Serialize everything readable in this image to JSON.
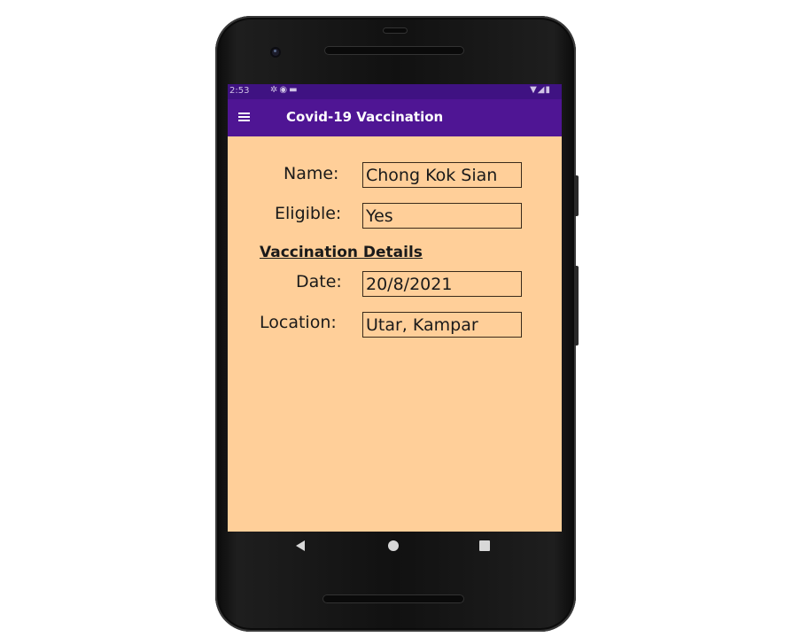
{
  "status_bar": {
    "time": "2:53",
    "left_icons": [
      "settings-icon",
      "notification-icon",
      "sd-card-icon"
    ],
    "right_icons": [
      "wifi-icon",
      "signal-icon",
      "battery-icon"
    ]
  },
  "app_bar": {
    "title": "Covid-19 Vaccination",
    "menu_icon": "hamburger-menu-icon",
    "background": "#4f1594"
  },
  "form": {
    "name_label": "Name:",
    "name_value": "Chong Kok Sian",
    "eligible_label": "Eligible:",
    "eligible_value": "Yes",
    "section_title": "Vaccination Details",
    "date_label": "Date:",
    "date_value": "20/8/2021",
    "location_label": "Location:",
    "location_value": "Utar, Kampar"
  },
  "nav_bar": {
    "buttons": [
      "back-icon",
      "home-icon",
      "recents-icon"
    ]
  },
  "colors": {
    "screen_background": "#FFCF99",
    "status_bar": "#3f1282",
    "accent": "#4f1594"
  }
}
